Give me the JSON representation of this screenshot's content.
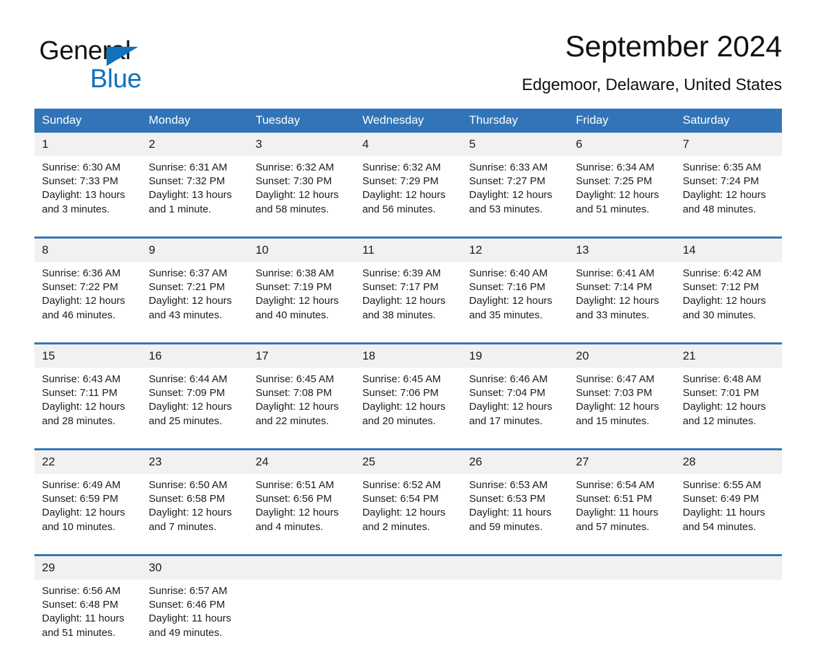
{
  "brand": {
    "name_part1": "General",
    "name_part2": "Blue",
    "triangle_color": "#1272bb"
  },
  "header": {
    "title": "September 2024",
    "subtitle": "Edgemoor, Delaware, United States",
    "accent_color": "#3175b8",
    "daynum_band_color": "#f1f1f1"
  },
  "calendar": {
    "weekday_headers": [
      "Sunday",
      "Monday",
      "Tuesday",
      "Wednesday",
      "Thursday",
      "Friday",
      "Saturday"
    ],
    "weeks": [
      [
        {
          "day": "1",
          "sunrise": "Sunrise: 6:30 AM",
          "sunset": "Sunset: 7:33 PM",
          "daylight_line1": "Daylight: 13 hours",
          "daylight_line2": "and 3 minutes."
        },
        {
          "day": "2",
          "sunrise": "Sunrise: 6:31 AM",
          "sunset": "Sunset: 7:32 PM",
          "daylight_line1": "Daylight: 13 hours",
          "daylight_line2": "and 1 minute."
        },
        {
          "day": "3",
          "sunrise": "Sunrise: 6:32 AM",
          "sunset": "Sunset: 7:30 PM",
          "daylight_line1": "Daylight: 12 hours",
          "daylight_line2": "and 58 minutes."
        },
        {
          "day": "4",
          "sunrise": "Sunrise: 6:32 AM",
          "sunset": "Sunset: 7:29 PM",
          "daylight_line1": "Daylight: 12 hours",
          "daylight_line2": "and 56 minutes."
        },
        {
          "day": "5",
          "sunrise": "Sunrise: 6:33 AM",
          "sunset": "Sunset: 7:27 PM",
          "daylight_line1": "Daylight: 12 hours",
          "daylight_line2": "and 53 minutes."
        },
        {
          "day": "6",
          "sunrise": "Sunrise: 6:34 AM",
          "sunset": "Sunset: 7:25 PM",
          "daylight_line1": "Daylight: 12 hours",
          "daylight_line2": "and 51 minutes."
        },
        {
          "day": "7",
          "sunrise": "Sunrise: 6:35 AM",
          "sunset": "Sunset: 7:24 PM",
          "daylight_line1": "Daylight: 12 hours",
          "daylight_line2": "and 48 minutes."
        }
      ],
      [
        {
          "day": "8",
          "sunrise": "Sunrise: 6:36 AM",
          "sunset": "Sunset: 7:22 PM",
          "daylight_line1": "Daylight: 12 hours",
          "daylight_line2": "and 46 minutes."
        },
        {
          "day": "9",
          "sunrise": "Sunrise: 6:37 AM",
          "sunset": "Sunset: 7:21 PM",
          "daylight_line1": "Daylight: 12 hours",
          "daylight_line2": "and 43 minutes."
        },
        {
          "day": "10",
          "sunrise": "Sunrise: 6:38 AM",
          "sunset": "Sunset: 7:19 PM",
          "daylight_line1": "Daylight: 12 hours",
          "daylight_line2": "and 40 minutes."
        },
        {
          "day": "11",
          "sunrise": "Sunrise: 6:39 AM",
          "sunset": "Sunset: 7:17 PM",
          "daylight_line1": "Daylight: 12 hours",
          "daylight_line2": "and 38 minutes."
        },
        {
          "day": "12",
          "sunrise": "Sunrise: 6:40 AM",
          "sunset": "Sunset: 7:16 PM",
          "daylight_line1": "Daylight: 12 hours",
          "daylight_line2": "and 35 minutes."
        },
        {
          "day": "13",
          "sunrise": "Sunrise: 6:41 AM",
          "sunset": "Sunset: 7:14 PM",
          "daylight_line1": "Daylight: 12 hours",
          "daylight_line2": "and 33 minutes."
        },
        {
          "day": "14",
          "sunrise": "Sunrise: 6:42 AM",
          "sunset": "Sunset: 7:12 PM",
          "daylight_line1": "Daylight: 12 hours",
          "daylight_line2": "and 30 minutes."
        }
      ],
      [
        {
          "day": "15",
          "sunrise": "Sunrise: 6:43 AM",
          "sunset": "Sunset: 7:11 PM",
          "daylight_line1": "Daylight: 12 hours",
          "daylight_line2": "and 28 minutes."
        },
        {
          "day": "16",
          "sunrise": "Sunrise: 6:44 AM",
          "sunset": "Sunset: 7:09 PM",
          "daylight_line1": "Daylight: 12 hours",
          "daylight_line2": "and 25 minutes."
        },
        {
          "day": "17",
          "sunrise": "Sunrise: 6:45 AM",
          "sunset": "Sunset: 7:08 PM",
          "daylight_line1": "Daylight: 12 hours",
          "daylight_line2": "and 22 minutes."
        },
        {
          "day": "18",
          "sunrise": "Sunrise: 6:45 AM",
          "sunset": "Sunset: 7:06 PM",
          "daylight_line1": "Daylight: 12 hours",
          "daylight_line2": "and 20 minutes."
        },
        {
          "day": "19",
          "sunrise": "Sunrise: 6:46 AM",
          "sunset": "Sunset: 7:04 PM",
          "daylight_line1": "Daylight: 12 hours",
          "daylight_line2": "and 17 minutes."
        },
        {
          "day": "20",
          "sunrise": "Sunrise: 6:47 AM",
          "sunset": "Sunset: 7:03 PM",
          "daylight_line1": "Daylight: 12 hours",
          "daylight_line2": "and 15 minutes."
        },
        {
          "day": "21",
          "sunrise": "Sunrise: 6:48 AM",
          "sunset": "Sunset: 7:01 PM",
          "daylight_line1": "Daylight: 12 hours",
          "daylight_line2": "and 12 minutes."
        }
      ],
      [
        {
          "day": "22",
          "sunrise": "Sunrise: 6:49 AM",
          "sunset": "Sunset: 6:59 PM",
          "daylight_line1": "Daylight: 12 hours",
          "daylight_line2": "and 10 minutes."
        },
        {
          "day": "23",
          "sunrise": "Sunrise: 6:50 AM",
          "sunset": "Sunset: 6:58 PM",
          "daylight_line1": "Daylight: 12 hours",
          "daylight_line2": "and 7 minutes."
        },
        {
          "day": "24",
          "sunrise": "Sunrise: 6:51 AM",
          "sunset": "Sunset: 6:56 PM",
          "daylight_line1": "Daylight: 12 hours",
          "daylight_line2": "and 4 minutes."
        },
        {
          "day": "25",
          "sunrise": "Sunrise: 6:52 AM",
          "sunset": "Sunset: 6:54 PM",
          "daylight_line1": "Daylight: 12 hours",
          "daylight_line2": "and 2 minutes."
        },
        {
          "day": "26",
          "sunrise": "Sunrise: 6:53 AM",
          "sunset": "Sunset: 6:53 PM",
          "daylight_line1": "Daylight: 11 hours",
          "daylight_line2": "and 59 minutes."
        },
        {
          "day": "27",
          "sunrise": "Sunrise: 6:54 AM",
          "sunset": "Sunset: 6:51 PM",
          "daylight_line1": "Daylight: 11 hours",
          "daylight_line2": "and 57 minutes."
        },
        {
          "day": "28",
          "sunrise": "Sunrise: 6:55 AM",
          "sunset": "Sunset: 6:49 PM",
          "daylight_line1": "Daylight: 11 hours",
          "daylight_line2": "and 54 minutes."
        }
      ],
      [
        {
          "day": "29",
          "sunrise": "Sunrise: 6:56 AM",
          "sunset": "Sunset: 6:48 PM",
          "daylight_line1": "Daylight: 11 hours",
          "daylight_line2": "and 51 minutes."
        },
        {
          "day": "30",
          "sunrise": "Sunrise: 6:57 AM",
          "sunset": "Sunset: 6:46 PM",
          "daylight_line1": "Daylight: 11 hours",
          "daylight_line2": "and 49 minutes."
        },
        {
          "day": "",
          "sunrise": "",
          "sunset": "",
          "daylight_line1": "",
          "daylight_line2": ""
        },
        {
          "day": "",
          "sunrise": "",
          "sunset": "",
          "daylight_line1": "",
          "daylight_line2": ""
        },
        {
          "day": "",
          "sunrise": "",
          "sunset": "",
          "daylight_line1": "",
          "daylight_line2": ""
        },
        {
          "day": "",
          "sunrise": "",
          "sunset": "",
          "daylight_line1": "",
          "daylight_line2": ""
        },
        {
          "day": "",
          "sunrise": "",
          "sunset": "",
          "daylight_line1": "",
          "daylight_line2": ""
        }
      ]
    ]
  }
}
